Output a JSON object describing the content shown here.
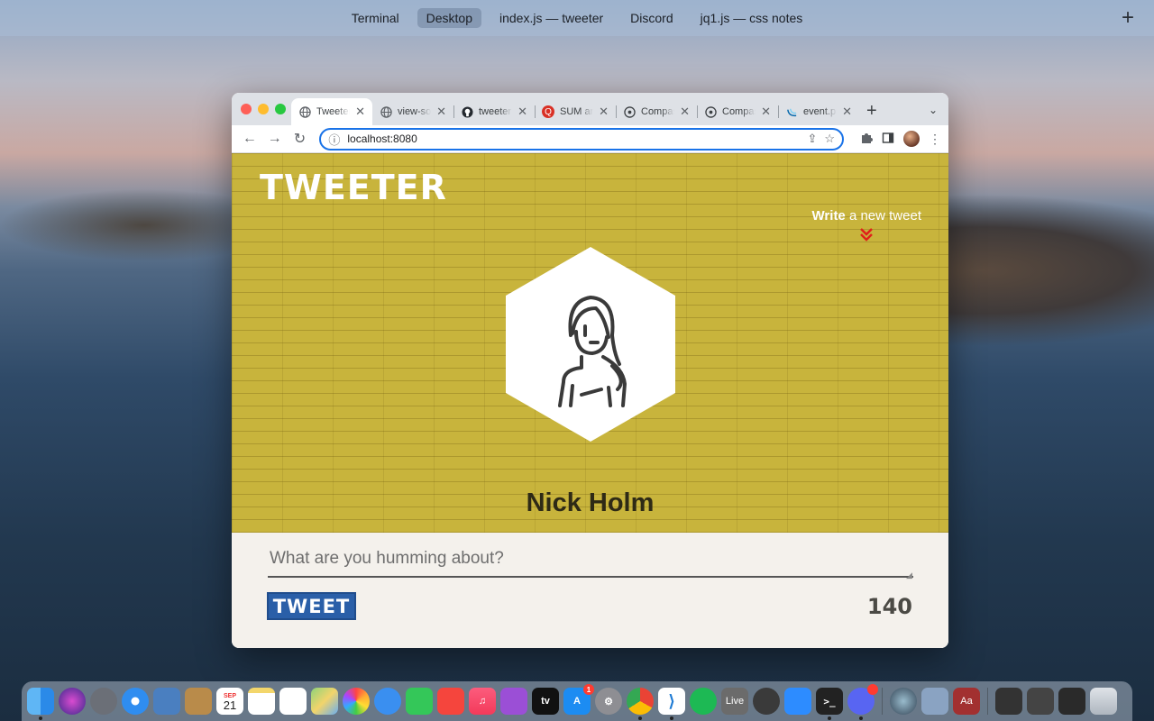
{
  "spaces": {
    "items": [
      {
        "label": "Terminal"
      },
      {
        "label": "Desktop"
      },
      {
        "label": "index.js — tweeter"
      },
      {
        "label": "Discord"
      },
      {
        "label": "jq1.js — css notes"
      }
    ],
    "add_label": "+"
  },
  "browser": {
    "tabs": [
      {
        "title": "Tweeter",
        "favicon": "globe-icon",
        "color": "#5f6368"
      },
      {
        "title": "view-source",
        "favicon": "globe-icon",
        "color": "#5f6368"
      },
      {
        "title": "tweeter",
        "favicon": "github-icon",
        "color": "#24292f"
      },
      {
        "title": "SUM and",
        "favicon": "ql-icon",
        "color": "#d93025"
      },
      {
        "title": "Compass",
        "favicon": "compass-icon",
        "color": "#5f6368"
      },
      {
        "title": "Compass",
        "favicon": "compass-icon",
        "color": "#5f6368"
      },
      {
        "title": "event.pre",
        "favicon": "jquery-icon",
        "color": "#0769ad"
      }
    ],
    "url": "localhost:8080"
  },
  "page": {
    "logo": "TWEETER",
    "write_bold": "Write",
    "write_rest": " a new tweet",
    "user_name": "Nick Holm",
    "tweet_placeholder": "What are you humming about?",
    "tweet_button": "TWEET",
    "char_count": "140"
  },
  "dock": {
    "calendar_month": "SEP",
    "calendar_day": "21",
    "appstore_badge": "1",
    "live_label": "Live",
    "tv_label": "tv",
    "dict_label": "Aa"
  },
  "colors": {
    "hero_bg": "#c8b43c",
    "accent_red": "#e0211a",
    "tweet_button": "#2a5fa8",
    "omnibox_focus": "#1a73e8"
  }
}
